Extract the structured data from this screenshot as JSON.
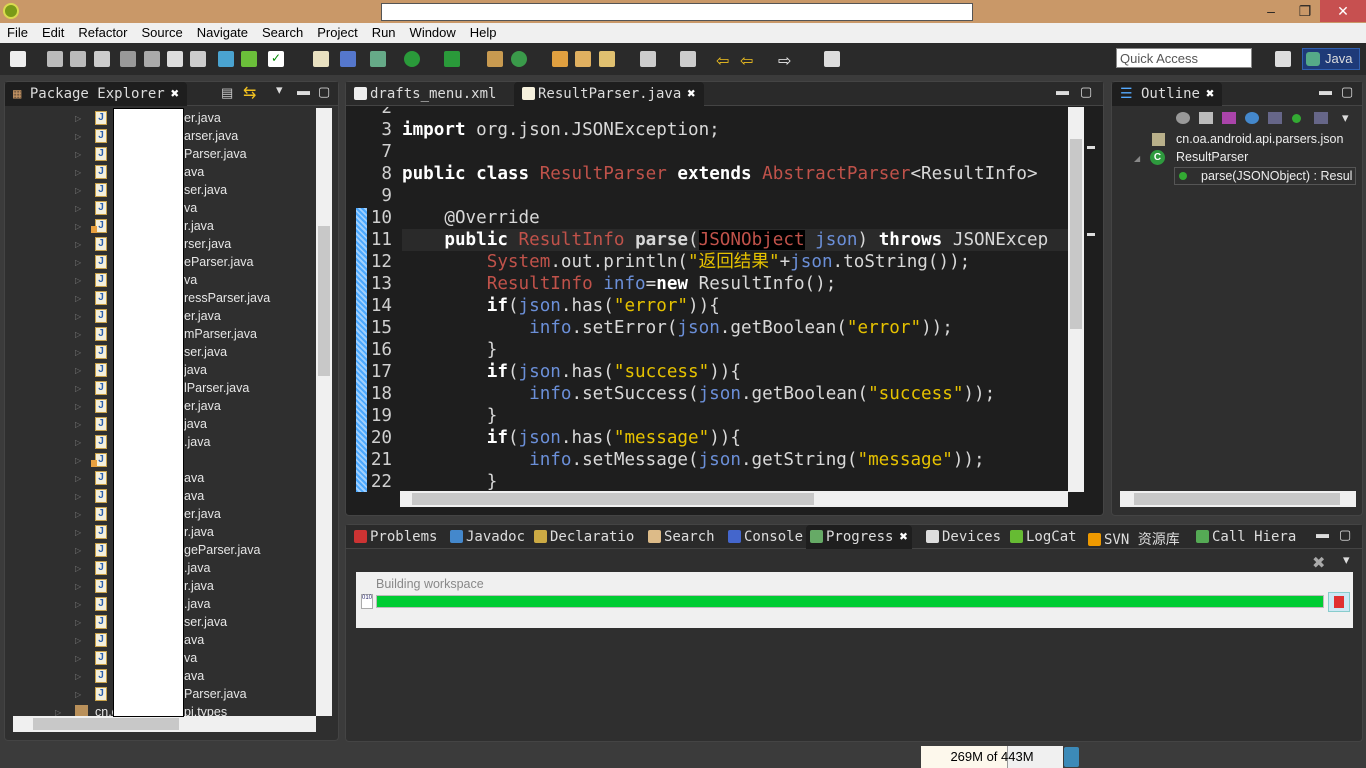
{
  "window": {
    "title": "",
    "controls": [
      "minimize",
      "restore",
      "close"
    ]
  },
  "menu": [
    "File",
    "Edit",
    "Refactor",
    "Source",
    "Navigate",
    "Search",
    "Project",
    "Run",
    "Window",
    "Help"
  ],
  "toolbar": {
    "quick_access_placeholder": "Quick Access",
    "perspective": "Java"
  },
  "package_explorer": {
    "title": "Package Explorer",
    "items": [
      {
        "label": "er.java"
      },
      {
        "label": "arser.java"
      },
      {
        "label": "Parser.java"
      },
      {
        "label": "ava"
      },
      {
        "label": "ser.java"
      },
      {
        "label": "va"
      },
      {
        "label": "r.java",
        "warning": true
      },
      {
        "label": "rser.java"
      },
      {
        "label": "eParser.java"
      },
      {
        "label": "va"
      },
      {
        "label": "ressParser.java"
      },
      {
        "label": "er.java"
      },
      {
        "label": "mParser.java"
      },
      {
        "label": "ser.java"
      },
      {
        "label": "java"
      },
      {
        "label": "lParser.java"
      },
      {
        "label": "er.java"
      },
      {
        "label": "java"
      },
      {
        "label": ".java"
      },
      {
        "label": "",
        "warning": true
      },
      {
        "label": "ava"
      },
      {
        "label": "ava"
      },
      {
        "label": "er.java"
      },
      {
        "label": "r.java"
      },
      {
        "label": "geParser.java"
      },
      {
        "label": ".java"
      },
      {
        "label": "r.java"
      },
      {
        "label": ".java"
      },
      {
        "label": "ser.java"
      },
      {
        "label": "ava"
      },
      {
        "label": "va"
      },
      {
        "label": "ava"
      },
      {
        "label": "Parser.java"
      }
    ],
    "package_row": {
      "prefix": "cn.o",
      "suffix": "pi.types"
    }
  },
  "editor": {
    "tabs": [
      {
        "label": "drafts_menu.xml",
        "active": false
      },
      {
        "label": "ResultParser.java",
        "active": true
      }
    ],
    "lines": [
      {
        "n": "2",
        "t": []
      },
      {
        "n": "3",
        "t": [
          [
            "import",
            "kw"
          ],
          [
            " org.json.JSONException;",
            "pl"
          ]
        ]
      },
      {
        "n": "7",
        "t": []
      },
      {
        "n": "8",
        "t": [
          [
            "public",
            "kw"
          ],
          [
            " ",
            "pl"
          ],
          [
            "class",
            "kw"
          ],
          [
            " ",
            "pl"
          ],
          [
            "ResultParser",
            "ty"
          ],
          [
            " ",
            "pl"
          ],
          [
            "extends",
            "kw"
          ],
          [
            " ",
            "pl"
          ],
          [
            "AbstractParser",
            "ty"
          ],
          [
            "<ResultInfo>",
            "pl"
          ]
        ]
      },
      {
        "n": "9",
        "t": []
      },
      {
        "n": "10",
        "t": [
          [
            "    @Override",
            "ann"
          ]
        ]
      },
      {
        "n": "11",
        "t": [
          [
            "    ",
            "pl"
          ],
          [
            "public",
            "kw"
          ],
          [
            " ",
            "pl"
          ],
          [
            "ResultInfo",
            "ty"
          ],
          [
            " ",
            "pl"
          ],
          [
            "parse",
            "mth"
          ],
          [
            "(",
            "pl"
          ],
          [
            "JSONObject",
            "hl"
          ],
          [
            " ",
            "pl"
          ],
          [
            "json",
            "fld"
          ],
          [
            ") ",
            "pl"
          ],
          [
            "throws",
            "kw"
          ],
          [
            " JSONExcep",
            "pl"
          ]
        ]
      },
      {
        "n": "12",
        "t": [
          [
            "        ",
            "pl"
          ],
          [
            "System",
            "ty"
          ],
          [
            ".out.println(",
            "pl"
          ],
          [
            "\"返回结果\"",
            "str"
          ],
          [
            "+",
            "pl"
          ],
          [
            "json",
            "fld"
          ],
          [
            ".toString());",
            "pl"
          ]
        ]
      },
      {
        "n": "13",
        "t": [
          [
            "        ",
            "pl"
          ],
          [
            "ResultInfo",
            "ty"
          ],
          [
            " ",
            "pl"
          ],
          [
            "info",
            "fld"
          ],
          [
            "=",
            "pl"
          ],
          [
            "new",
            "kw"
          ],
          [
            " ResultInfo();",
            "pl"
          ]
        ]
      },
      {
        "n": "14",
        "t": [
          [
            "        ",
            "pl"
          ],
          [
            "if",
            "kw"
          ],
          [
            "(",
            "pl"
          ],
          [
            "json",
            "fld"
          ],
          [
            ".has(",
            "pl"
          ],
          [
            "\"error\"",
            "str"
          ],
          [
            ")){",
            "pl"
          ]
        ]
      },
      {
        "n": "15",
        "t": [
          [
            "            ",
            "pl"
          ],
          [
            "info",
            "fld"
          ],
          [
            ".setError(",
            "pl"
          ],
          [
            "json",
            "fld"
          ],
          [
            ".getBoolean(",
            "pl"
          ],
          [
            "\"error\"",
            "str"
          ],
          [
            "));",
            "pl"
          ]
        ]
      },
      {
        "n": "16",
        "t": [
          [
            "        }",
            "pl"
          ]
        ]
      },
      {
        "n": "17",
        "t": [
          [
            "        ",
            "pl"
          ],
          [
            "if",
            "kw"
          ],
          [
            "(",
            "pl"
          ],
          [
            "json",
            "fld"
          ],
          [
            ".has(",
            "pl"
          ],
          [
            "\"success\"",
            "str"
          ],
          [
            ")){",
            "pl"
          ]
        ]
      },
      {
        "n": "18",
        "t": [
          [
            "            ",
            "pl"
          ],
          [
            "info",
            "fld"
          ],
          [
            ".setSuccess(",
            "pl"
          ],
          [
            "json",
            "fld"
          ],
          [
            ".getBoolean(",
            "pl"
          ],
          [
            "\"success\"",
            "str"
          ],
          [
            "));",
            "pl"
          ]
        ]
      },
      {
        "n": "19",
        "t": [
          [
            "        }",
            "pl"
          ]
        ]
      },
      {
        "n": "20",
        "t": [
          [
            "        ",
            "pl"
          ],
          [
            "if",
            "kw"
          ],
          [
            "(",
            "pl"
          ],
          [
            "json",
            "fld"
          ],
          [
            ".has(",
            "pl"
          ],
          [
            "\"message\"",
            "str"
          ],
          [
            ")){",
            "pl"
          ]
        ]
      },
      {
        "n": "21",
        "t": [
          [
            "            ",
            "pl"
          ],
          [
            "info",
            "fld"
          ],
          [
            ".setMessage(",
            "pl"
          ],
          [
            "json",
            "fld"
          ],
          [
            ".getString(",
            "pl"
          ],
          [
            "\"message\"",
            "str"
          ],
          [
            "));",
            "pl"
          ]
        ]
      },
      {
        "n": "22",
        "t": [
          [
            "        }",
            "pl"
          ]
        ]
      }
    ]
  },
  "outline": {
    "title": "Outline",
    "package": "cn.oa.android.api.parsers.json",
    "class": "ResultParser",
    "method": "parse(JSONObject) : Resul"
  },
  "bottom": {
    "tabs": [
      "Problems",
      "Javadoc",
      "Declaratio",
      "Search",
      "Console",
      "Progress",
      "Devices",
      "LogCat",
      "SVN 资源库",
      "Call Hiera"
    ],
    "active_tab": "Progress",
    "task": "Building workspace",
    "progress_percent": 100
  },
  "status": {
    "memory": "269M of 443M",
    "memory_used_fraction": 0.61
  },
  "colors": {
    "titlebar": "#c99868",
    "progress": "#00cc33",
    "editor_bg": "#1e1e1e"
  }
}
